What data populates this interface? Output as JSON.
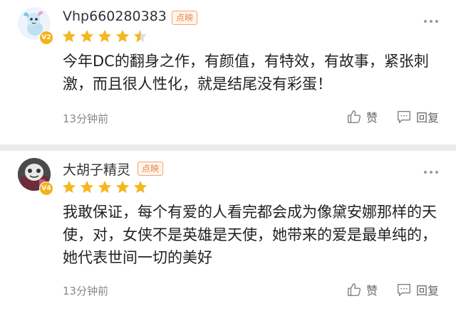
{
  "comments": [
    {
      "username": "Vhp660280383",
      "tag": "点映",
      "level": "V2",
      "rating": 4.5,
      "text": "今年DC的翻身之作，有颜值，有特效，有故事，紧张刺激，而且很人性化，就是结尾没有彩蛋！",
      "time": "13分钟前",
      "like_label": "赞",
      "reply_label": "回复"
    },
    {
      "username": "大胡子精灵",
      "tag": "点映",
      "level": "V4",
      "rating": 5,
      "text": "我敢保证，每个有爱的人看完都会成为像黛安娜那样的天使，对，女侠不是英雄是天使，她带来的爱是最单纯的，她代表世间一切的美好",
      "time": "13分钟前",
      "like_label": "赞",
      "reply_label": "回复"
    }
  ],
  "colors": {
    "star": "#f5b71f",
    "tag_text": "#e8844a",
    "level_badge": "#f2b21b",
    "divider": "#ececec"
  },
  "icons": [
    "avatar",
    "level-badge",
    "star-icon",
    "more-icon",
    "thumbs-up-icon",
    "reply-icon"
  ]
}
